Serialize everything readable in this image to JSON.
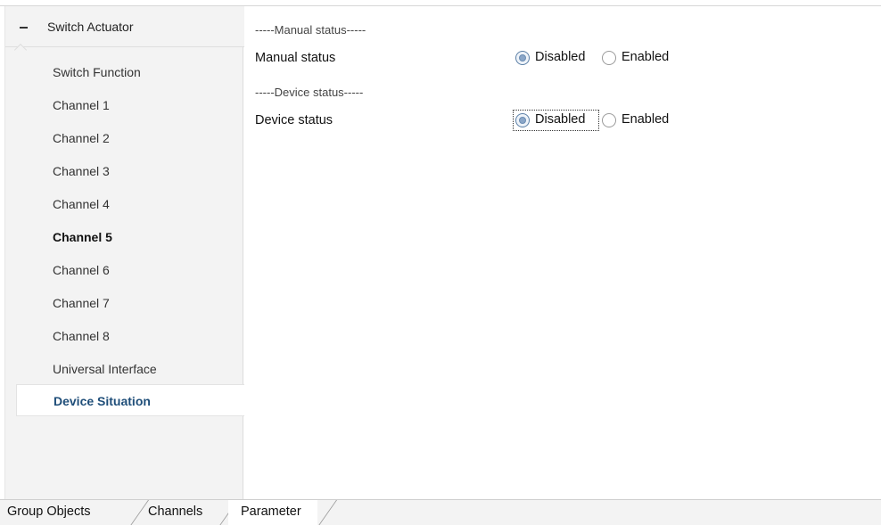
{
  "sidebar": {
    "header": {
      "label": "Switch Actuator"
    },
    "items": [
      {
        "label": "Switch Function"
      },
      {
        "label": "Channel 1"
      },
      {
        "label": "Channel 2"
      },
      {
        "label": "Channel 3"
      },
      {
        "label": "Channel 4"
      },
      {
        "label": "Channel 5",
        "bold": true
      },
      {
        "label": "Channel 6"
      },
      {
        "label": "Channel 7"
      },
      {
        "label": "Channel 8"
      },
      {
        "label": "Universal Interface"
      },
      {
        "label": "Device Situation",
        "selected": true
      }
    ]
  },
  "main": {
    "manual_section": "-----Manual status-----",
    "manual_label": "Manual status",
    "manual_options": {
      "disabled": "Disabled",
      "enabled": "Enabled",
      "selected": "Disabled"
    },
    "device_section": "-----Device status-----",
    "device_label": "Device status",
    "device_options": {
      "disabled": "Disabled",
      "enabled": "Enabled",
      "selected": "Disabled"
    }
  },
  "tabs": [
    {
      "label": "Group Objects"
    },
    {
      "label": "Channels"
    },
    {
      "label": "Parameter",
      "active": true
    }
  ],
  "colors": {
    "selected_item": "#1f4e79",
    "radio_checked": "#8aa6c8"
  }
}
